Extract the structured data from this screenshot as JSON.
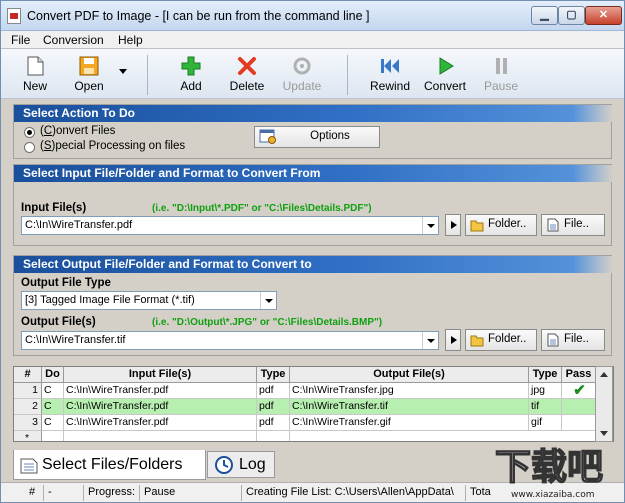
{
  "window": {
    "title": "Convert PDF to Image - [I can be run from the command line ]"
  },
  "menu": [
    "File",
    "Conversion",
    "Help"
  ],
  "toolbar": {
    "new": "New",
    "open": "Open",
    "add": "Add",
    "delete": "Delete",
    "update": "Update",
    "rewind": "Rewind",
    "convert": "Convert",
    "pause": "Pause"
  },
  "action": {
    "header": "Select Action To Do",
    "convert_files_prefix": "(",
    "convert_files_key": "C",
    "convert_files_rest": ")onvert Files",
    "special_prefix": "(",
    "special_key": "S",
    "special_rest": ")pecial Processing on files",
    "options_label": "Options"
  },
  "input": {
    "header": "Select Input File/Folder and Format to Convert From",
    "label": "Input File(s)",
    "hint": "(i.e. \"D:\\Input\\*.PDF\"  or \"C:\\Files\\Details.PDF\")",
    "value": "C:\\In\\WireTransfer.pdf",
    "folder_btn": "Folder..",
    "file_btn": "File.."
  },
  "output": {
    "header": "Select Output File/Folder and Format to Convert to",
    "type_label": "Output File Type",
    "type_value": "[3] Tagged Image File Format (*.tif)",
    "label": "Output File(s)",
    "hint": "(i.e. \"D:\\Output\\*.JPG\"  or \"C:\\Files\\Details.BMP\")",
    "value": "C:\\In\\WireTransfer.tif",
    "folder_btn": "Folder..",
    "file_btn": "File.."
  },
  "grid": {
    "headers": [
      "#",
      "Do",
      "Input File(s)",
      "Type",
      "Output File(s)",
      "Type",
      "Pass"
    ],
    "rows": [
      {
        "num": "1",
        "do": "C",
        "input": "C:\\In\\WireTransfer.pdf",
        "itype": "pdf",
        "output": "C:\\In\\WireTransfer.jpg",
        "otype": "jpg",
        "pass": "✔"
      },
      {
        "num": "2",
        "do": "C",
        "input": "C:\\In\\WireTransfer.pdf",
        "itype": "pdf",
        "output": "C:\\In\\WireTransfer.tif",
        "otype": "tif",
        "pass": ""
      },
      {
        "num": "3",
        "do": "C",
        "input": "C:\\In\\WireTransfer.pdf",
        "itype": "pdf",
        "output": "C:\\In\\WireTransfer.gif",
        "otype": "gif",
        "pass": ""
      },
      {
        "num": "*",
        "do": "",
        "input": "",
        "itype": "",
        "output": "",
        "otype": "",
        "pass": ""
      }
    ]
  },
  "tabs": {
    "files": "Select Files/Folders",
    "log": "Log"
  },
  "status": {
    "num": "#",
    "dash": "-",
    "progress": "Progress:",
    "state": "Pause",
    "creating": "Creating File List: C:\\Users\\Allen\\AppData\\",
    "total": "Tota"
  },
  "watermark": {
    "text": "下载吧",
    "url": "www.xiazaiba.com"
  },
  "colors": {
    "header_blue": "#1a4f9b",
    "hint_green": "#10a010",
    "selected_row": "#b7efb0",
    "check_green": "#1c8a1c"
  }
}
